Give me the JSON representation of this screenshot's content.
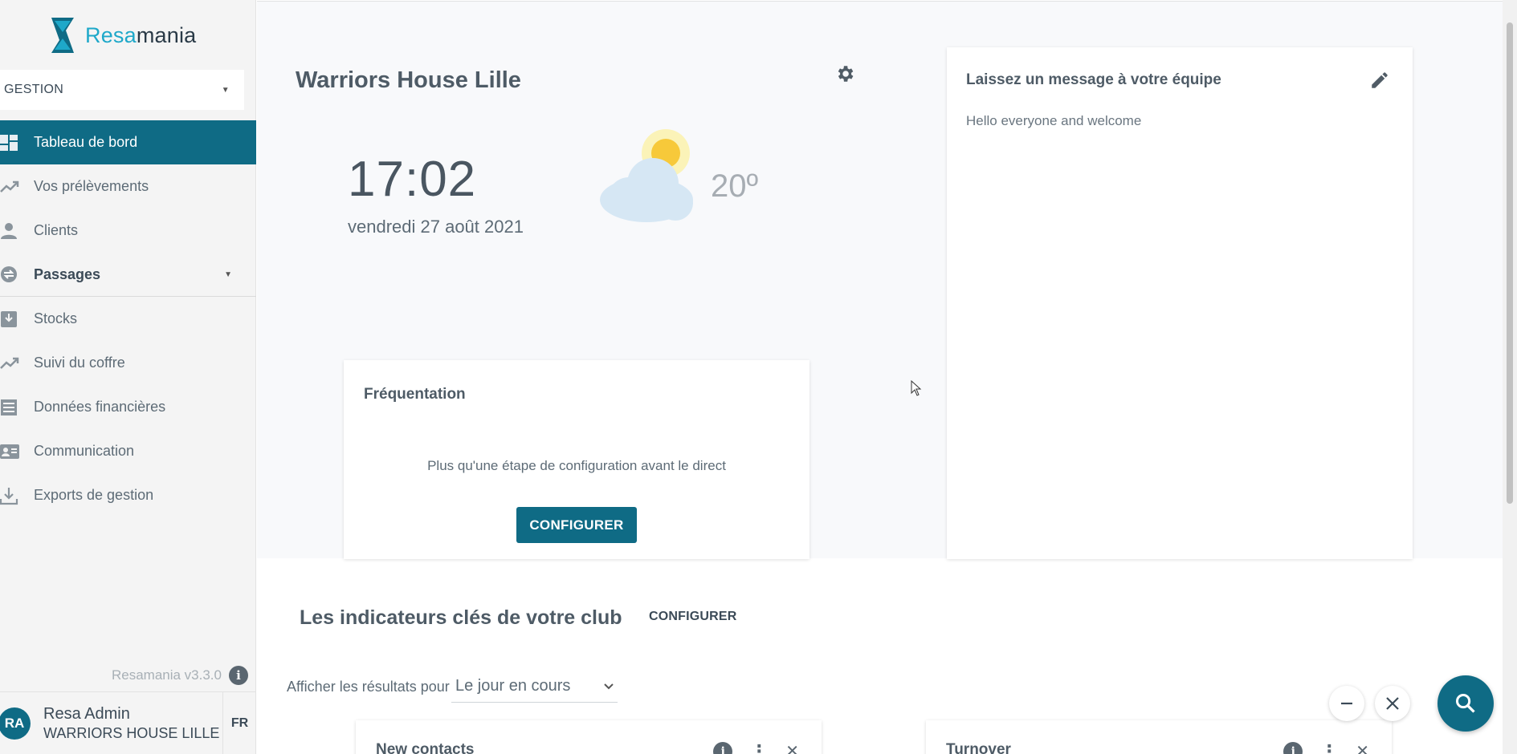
{
  "brand": {
    "name_part1": "Resa",
    "name_part2": "mania"
  },
  "mode_select": {
    "value": "GESTION"
  },
  "nav": {
    "items": [
      {
        "label": "Tableau de bord"
      },
      {
        "label": "Vos prélèvements"
      },
      {
        "label": "Clients"
      },
      {
        "label": "Passages"
      },
      {
        "label": "Stocks"
      },
      {
        "label": "Suivi du coffre"
      },
      {
        "label": "Données financières"
      },
      {
        "label": "Communication"
      },
      {
        "label": "Exports de gestion"
      }
    ]
  },
  "version": {
    "label": "Resamania v3.3.0",
    "info_glyph": "i"
  },
  "user": {
    "initials": "RA",
    "name": "Resa Admin",
    "club": "WARRIORS HOUSE LILLE",
    "lang": "FR"
  },
  "header": {
    "club_title": "Warriors House Lille"
  },
  "clock": {
    "time": "17:02",
    "date": "vendredi 27 août 2021"
  },
  "weather": {
    "temp": "20º",
    "icon": "partly-cloudy-icon"
  },
  "frequentation": {
    "title": "Fréquentation",
    "message": "Plus qu'une étape de configuration avant le direct",
    "button": "CONFIGURER"
  },
  "team_message": {
    "title": "Laissez un message à votre équipe",
    "body": "Hello everyone and welcome"
  },
  "indicators": {
    "title": "Les indicateurs clés de votre club",
    "config_button": "CONFIGURER",
    "filter_label": "Afficher les résultats pour",
    "filter_value": "Le jour en cours",
    "widgets": [
      {
        "title": "New contacts"
      },
      {
        "title": "Turnover"
      }
    ],
    "widget_info_glyph": "i",
    "widget_menu_glyph": "⋮",
    "widget_close_glyph": "✕"
  },
  "colors": {
    "accent": "#0f6b85",
    "logo_accent": "#1ea8c9",
    "sidebar_bg": "#f4f4f4"
  }
}
